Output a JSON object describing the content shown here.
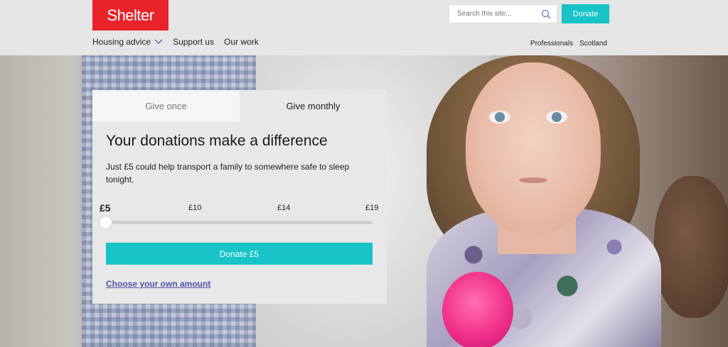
{
  "header": {
    "logo": "Shelter",
    "search_placeholder": "Search this site...",
    "donate_label": "Donate",
    "nav": [
      {
        "label": "Housing advice"
      },
      {
        "label": "Support us"
      },
      {
        "label": "Our work"
      }
    ],
    "utility": [
      "Professionals",
      "Scotland"
    ]
  },
  "panel": {
    "tabs": [
      "Give once",
      "Give monthly"
    ],
    "active_tab": "Give monthly",
    "title": "Your donations make a difference",
    "description": "Just £5 could help transport a family to somewhere safe to sleep tonight.",
    "amounts": [
      "£5",
      "£10",
      "£14",
      "£19"
    ],
    "selected_amount": "£5",
    "donate_button": "Donate £5",
    "own_amount_link": "Choose your own amount"
  },
  "colors": {
    "brand_red": "#e8232a",
    "accent_teal": "#17c3c6",
    "link_blue": "#4a54a8"
  },
  "icons": {
    "search": "search-icon",
    "chevron": "chevron-down-icon"
  }
}
